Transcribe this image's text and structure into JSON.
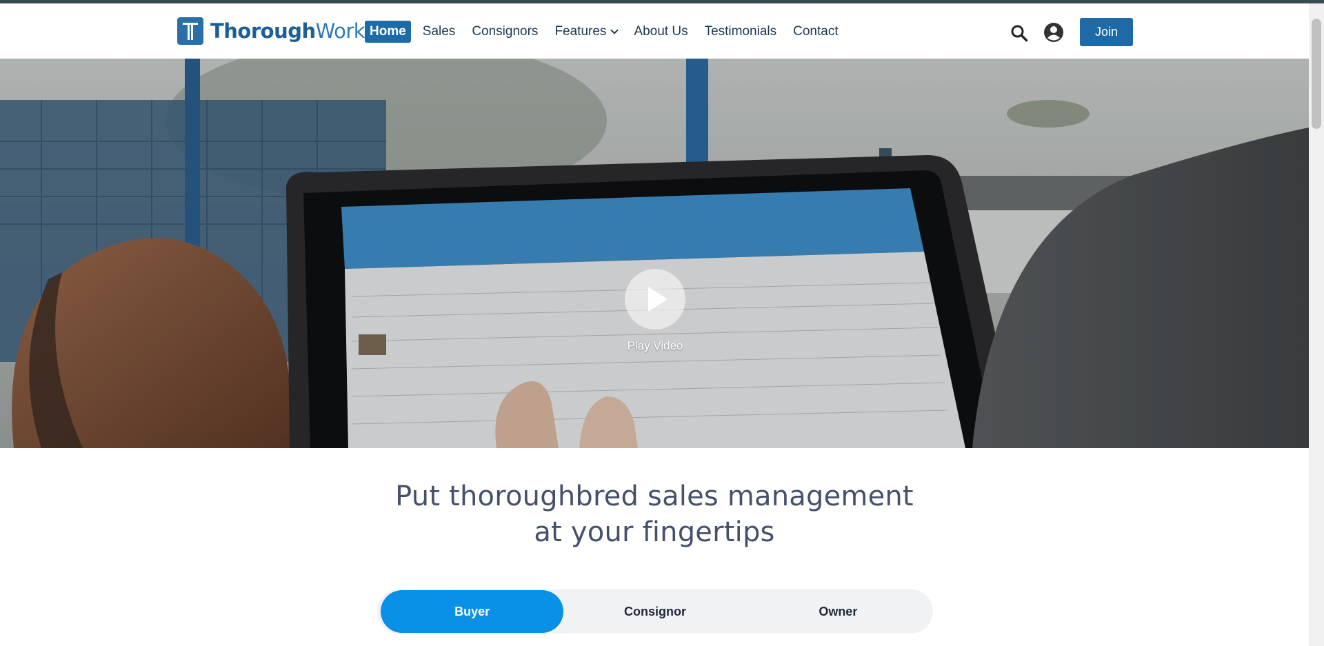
{
  "brand": {
    "name_part1": "Thorough",
    "name_part2": "Works"
  },
  "nav": {
    "items": [
      {
        "label": "Home",
        "active": true
      },
      {
        "label": "Sales"
      },
      {
        "label": "Consignors"
      },
      {
        "label": "Features",
        "has_dropdown": true
      },
      {
        "label": "About Us"
      },
      {
        "label": "Testimonials"
      },
      {
        "label": "Contact"
      }
    ]
  },
  "header_actions": {
    "search_icon": "search-icon",
    "account_icon": "user-avatar-icon",
    "join_label": "Join"
  },
  "hero": {
    "play_label": "Play Video"
  },
  "headline": "Put thoroughbred sales management at your fingertips",
  "tabs": [
    {
      "label": "Buyer",
      "active": true
    },
    {
      "label": "Consignor"
    },
    {
      "label": "Owner"
    }
  ],
  "colors": {
    "primary": "#1e6aa6",
    "tab_active": "#0891e6",
    "headline": "#45506a"
  }
}
